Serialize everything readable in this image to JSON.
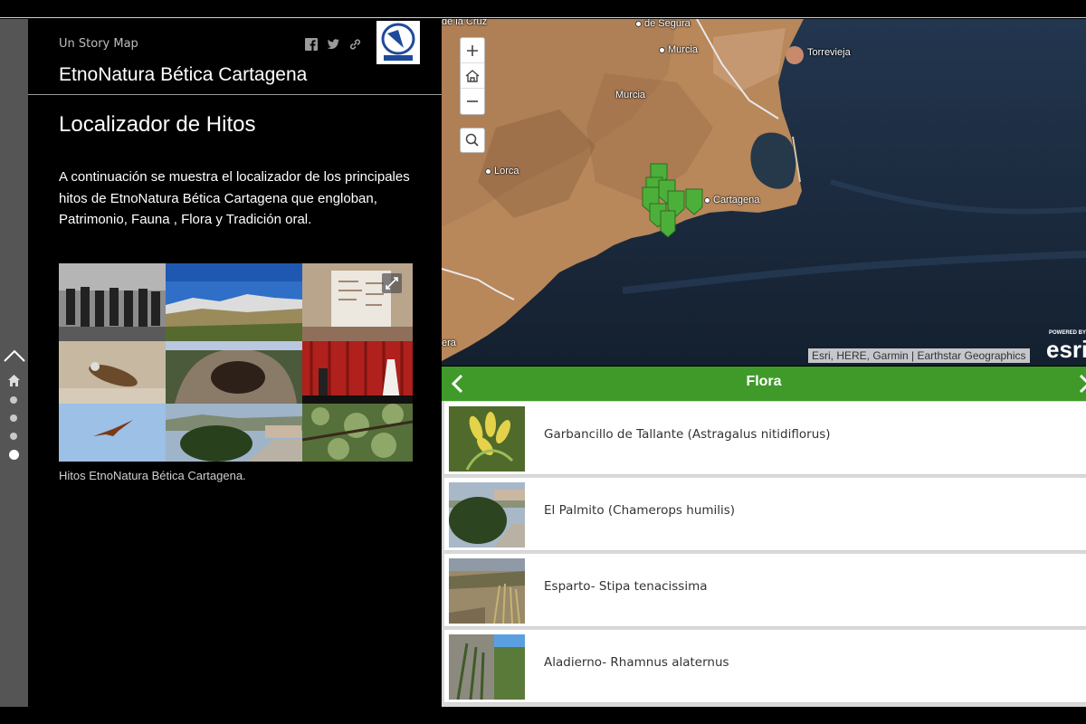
{
  "sidebar_nav": {
    "up_icon": "chevron-up-icon",
    "home_icon": "home-icon",
    "dots": 4,
    "active_dot": 4
  },
  "panel": {
    "subtitle": "Un Story Map",
    "title": "EtnoNatura Bética Cartagena",
    "social": [
      "facebook-icon",
      "twitter-icon",
      "link-icon"
    ],
    "heading": "Localizador de Hitos",
    "intro": "A continuación se muestra el localizador de los principales hitos de EtnoNatura Bética Cartagena que engloban, Patrimonio, Fauna , Flora y Tradición oral.",
    "caption": "Hitos EtnoNatura Bética Cartagena."
  },
  "map": {
    "places": [
      {
        "name": "de la Cruz",
        "dot": false
      },
      {
        "name": "de Segura",
        "dot": true
      },
      {
        "name": "Murcia",
        "dot": true
      },
      {
        "name": "Murcia",
        "dot": false
      },
      {
        "name": "Torrevieja",
        "dot": false
      },
      {
        "name": "Lorca",
        "dot": true
      },
      {
        "name": "Cartagena",
        "dot": true
      },
      {
        "name": "era",
        "dot": false
      }
    ],
    "attribution": "Esri, HERE, Garmin | Earthstar Geographics",
    "powered_by": "POWERED BY",
    "brand": "esri",
    "marker_color": "#4caf3a"
  },
  "flora": {
    "title": "Flora",
    "items": [
      {
        "label": "Garbancillo de Tallante (Astragalus nitidiflorus)"
      },
      {
        "label": "El Palmito (Chamerops humilis)"
      },
      {
        "label": "Esparto- Stipa tenacissima"
      },
      {
        "label": "Aladierno- Rhamnus alaternus"
      }
    ],
    "header_color": "#3f9a2a"
  }
}
